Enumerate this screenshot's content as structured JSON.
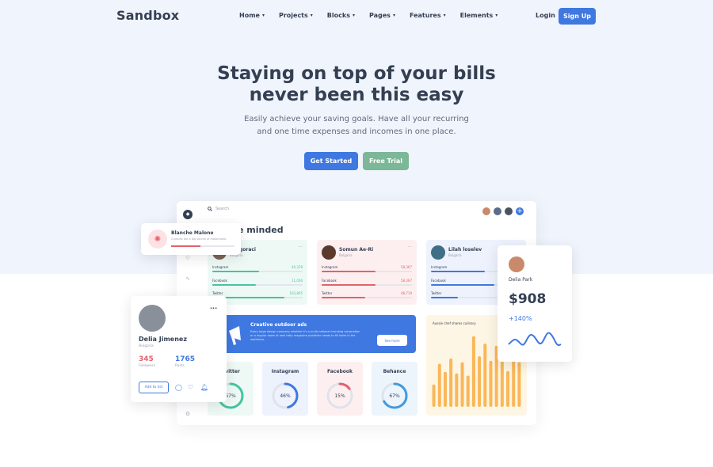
{
  "nav": {
    "logo": "Sandbox",
    "items": [
      "Home",
      "Projects",
      "Blocks",
      "Pages",
      "Features",
      "Elements"
    ],
    "login": "Login",
    "signup": "Sign Up"
  },
  "hero": {
    "title_line1": "Staying on top of your bills",
    "title_line2": "never been this easy",
    "lead_line1": "Easily achieve your saving goals. Have all your recurring",
    "lead_line2": "and one time expenses and incomes in one place.",
    "primary_button": "Get Started",
    "secondary_button": "Free Trial"
  },
  "dashboard": {
    "search_placeholder": "Search",
    "title": "e minded",
    "profiles": [
      {
        "name": "Gregoraci",
        "country": "Bulgaria",
        "rows": [
          {
            "label": "Instagram",
            "value": "40,378",
            "fill": 0.52
          },
          {
            "label": "Facebook",
            "value": "11,036",
            "fill": 0.48
          },
          {
            "label": "Twitter",
            "value": "103,805",
            "fill": 0.8
          }
        ]
      },
      {
        "name": "Somun Ae-Ri",
        "country": "Bulgaria",
        "rows": [
          {
            "label": "Instagram",
            "value": "58,367",
            "fill": 0.6
          },
          {
            "label": "Facebook",
            "value": "58,367",
            "fill": 0.6
          },
          {
            "label": "Twitter",
            "value": "48,719",
            "fill": 0.48
          }
        ]
      },
      {
        "name": "Lilah loselev",
        "country": "Bulgaria",
        "rows": [
          {
            "label": "Instagram",
            "value": "",
            "fill": 0.6
          },
          {
            "label": "Facebook",
            "value": "",
            "fill": 0.7
          },
          {
            "label": "Twitter",
            "value": "",
            "fill": 0.3
          }
        ]
      }
    ],
    "banner": {
      "title": "Creative outdoor ads",
      "description": "Every large design company whether it's a multi-national branding corporation or a regular down at heel tatty magazine publisher needs to fill holes in the workforce.",
      "button": "See more"
    },
    "stats": [
      {
        "label": "Twitter",
        "percent": 67,
        "color": "#45c4a0",
        "bg": "#eef9f5"
      },
      {
        "label": "Instagram",
        "percent": 46,
        "color": "#3f78e0",
        "bg": "#edf2fc"
      },
      {
        "label": "Facebook",
        "percent": 15,
        "color": "#e2626b",
        "bg": "#fdeff0"
      },
      {
        "label": "Behance",
        "percent": 67,
        "color": "#3f9ae0",
        "bg": "#ecf4fc"
      }
    ],
    "chart_title": "Aussie chef shares culinary"
  },
  "chart_data": {
    "type": "bar",
    "title": "Aussie chef shares culinary",
    "values": [
      30,
      58,
      47,
      65,
      45,
      60,
      42,
      95,
      68,
      85,
      62,
      82,
      70,
      48,
      75,
      60
    ],
    "ylim": [
      0,
      100
    ],
    "color": "#fab758"
  },
  "float_notification": {
    "name": "Blanche Malone",
    "text": "Curtains are a big source of malocrostic",
    "progress": 0.46
  },
  "float_profile": {
    "name": "Delia Jimenez",
    "country": "Bulgaria",
    "followers_value": "345",
    "followers_label": "Followers",
    "posts_value": "1765",
    "posts_label": "Posts",
    "button": "Add to list"
  },
  "float_balance": {
    "name": "Delia Park",
    "amount": "$908",
    "change": "+140%"
  },
  "colors": {
    "primary": "#3f78e0",
    "green": "#7cb798",
    "red": "#e2626b",
    "yellow": "#fab758",
    "hero_bg": "#f0f4fc"
  }
}
